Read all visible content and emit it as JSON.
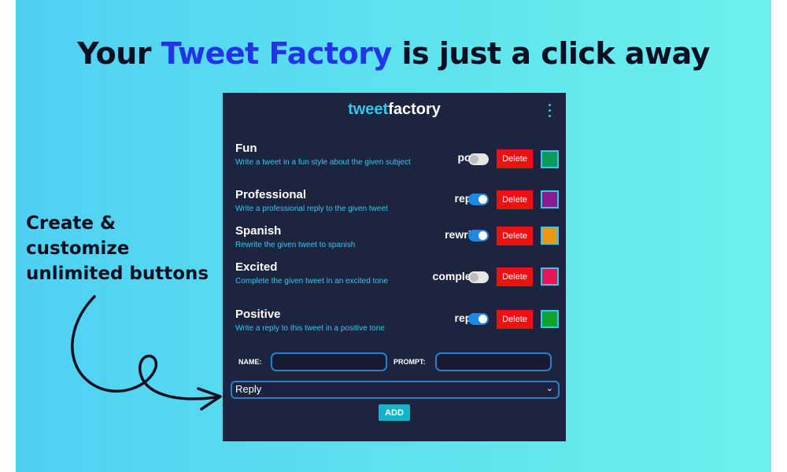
{
  "headline": {
    "pre": "Your ",
    "accent": "Tweet Factory",
    "post": " is just a click away"
  },
  "side_text": {
    "line1": "Create &",
    "line2": "customize",
    "line3": "unlimited buttons"
  },
  "app": {
    "brand_part1": "tweet",
    "brand_part2": "factory",
    "rows": [
      {
        "name": "Fun",
        "description": "Write a tweet in a fun style about the given subject",
        "type": "post",
        "enabled": false,
        "delete_label": "Delete",
        "color": "#0e9a5a"
      },
      {
        "name": "Professional",
        "description": "Write a professional reply to the given tweet",
        "type": "reply",
        "enabled": true,
        "delete_label": "Delete",
        "color": "#8a1a8e"
      },
      {
        "name": "Spanish",
        "description": "Rewrite the given tweet to spanish",
        "type": "rewrite",
        "enabled": true,
        "delete_label": "Delete",
        "color": "#e89a17"
      },
      {
        "name": "Excited",
        "description": "Complete the given tweet in an excited tone",
        "type": "complete",
        "enabled": false,
        "delete_label": "Delete",
        "color": "#ea1556"
      },
      {
        "name": "Positive",
        "description": "Write a reply to this tweet in a positive tone",
        "type": "reply",
        "enabled": true,
        "delete_label": "Delete",
        "color": "#12a12a"
      }
    ],
    "name_label": "NAME:",
    "name_value": "",
    "prompt_label": "PROMPT:",
    "prompt_value": "",
    "type_select": "Reply",
    "add_label": "ADD"
  },
  "colors": {
    "accent": "#2233e8",
    "panel": "#1d2440",
    "brand_cyan": "#2ec9ee",
    "delete": "#ee1111",
    "toggle_on": "#1e88e5"
  },
  "icons": {
    "menu": "kebab-menu-icon",
    "dropdown": "chevron-down-icon",
    "decor": "curly-arrow-icon"
  }
}
